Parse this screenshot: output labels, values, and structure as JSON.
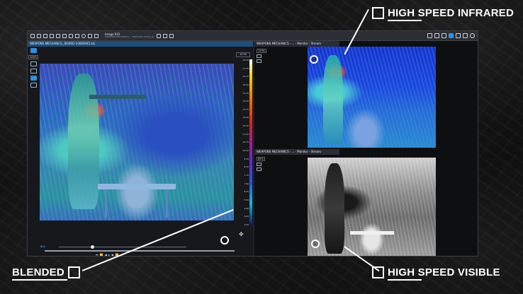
{
  "app": {
    "toolbar": {
      "image_roi_title": "Image ROI",
      "image_roi_subtitle": "WEAPONS MECHANICS -- 2862A945-0001S.atc"
    },
    "left_pane": {
      "title": "WEAPONS MECHANICS_ BOARD-1068S945.atc",
      "zoom": "100%",
      "scale_top": "19.94",
      "scale_values": [
        "18.25",
        "17.50",
        "16.75",
        "16.00",
        "15.25",
        "14.50",
        "13.75",
        "13.00",
        "12.25",
        "11.50",
        "10.75",
        "10.00",
        "9.25",
        "8.50",
        "7.75",
        "7.00",
        "6.25",
        "5.50",
        "4.96",
        "4.00",
        "3.25"
      ],
      "timeline": {
        "frame_label": "B02",
        "position_fraction": 0.26
      }
    },
    "right_top_pane": {
      "title": "WEAPONS MECHANICS - ... - Monitor - Stream",
      "zoom": "113%"
    },
    "right_bottom_pane": {
      "title": "WEAPONS MECHANICS - ... - Monitor - Stream",
      "zoom": "62%"
    }
  },
  "callouts": {
    "infrared": {
      "prefix": "HIGH",
      "rest": " SPEED INFRARED"
    },
    "visible": {
      "prefix": "HIGH",
      "rest": " SPEED VISIBLE"
    },
    "blended": {
      "prefix": "BLENDED",
      "rest": ""
    }
  },
  "colors": {
    "accent": "#2f8fe0",
    "callout_text": "#ffffff"
  }
}
